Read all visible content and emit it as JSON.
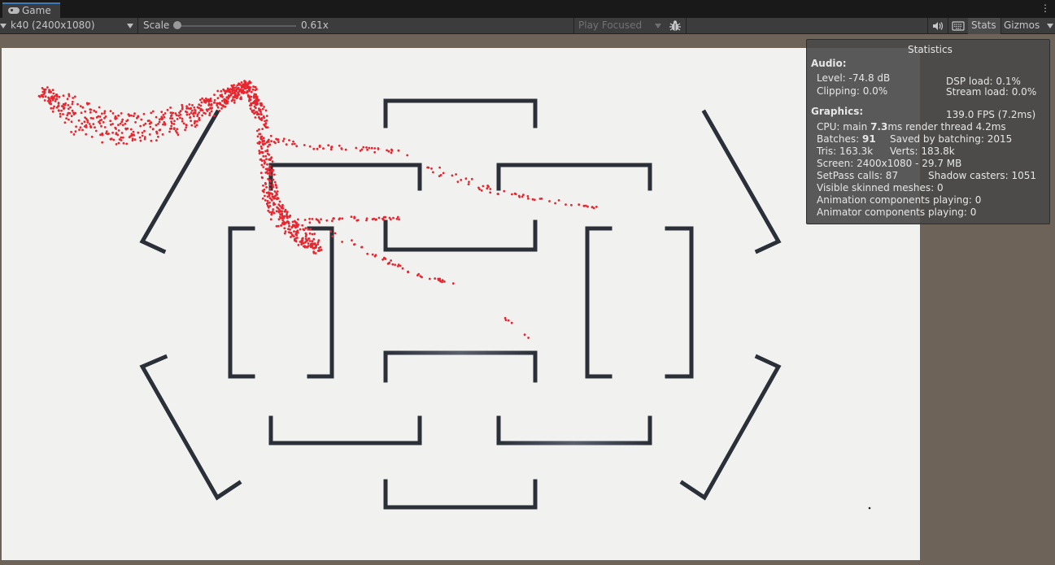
{
  "window": {
    "tab_label": "Game",
    "tab_icon": "gamepad-icon",
    "menu_icon": "kebab-menu-icon"
  },
  "toolbar": {
    "resolution": "k40 (2400x1080)",
    "scale_label": "Scale",
    "scale_value": "0.61x",
    "scale_level": 0.05,
    "play_mode": "Play Focused",
    "bug_icon": "bug-icon",
    "audio_icon": "speaker-icon",
    "keyboard_icon": "keyboard-icon",
    "stats_label": "Stats",
    "gizmos_label": "Gizmos"
  },
  "stats": {
    "title": "Statistics",
    "audio_header": "Audio:",
    "level": "Level: -74.8 dB",
    "dsp_load": "DSP load: 0.1%",
    "clipping": "Clipping: 0.0%",
    "stream_load": "Stream load: 0.0%",
    "graphics_header": "Graphics:",
    "fps": "139.0 FPS (7.2ms)",
    "cpu_prefix": "CPU: main ",
    "cpu_main": "7.3",
    "cpu_suffix": "ms  render thread 4.2ms",
    "batches_prefix": "Batches: ",
    "batches": "91",
    "saved_by_batching": "Saved by batching: 2015",
    "tris": "Tris: 163.3k",
    "verts": "Verts: 183.8k",
    "screen": "Screen: 2400x1080 - 29.7 MB",
    "setpass": "SetPass calls: 87",
    "shadow_casters": "Shadow casters: 1051",
    "skinned": "Visible skinned meshes: 0",
    "animation": "Animation components playing: 0",
    "animator": "Animator components playing: 0"
  },
  "colors": {
    "particle": "#e8262f",
    "frame": "#2a2f38",
    "viewport": "#f1f1f0",
    "accent": "#3a79bb"
  }
}
